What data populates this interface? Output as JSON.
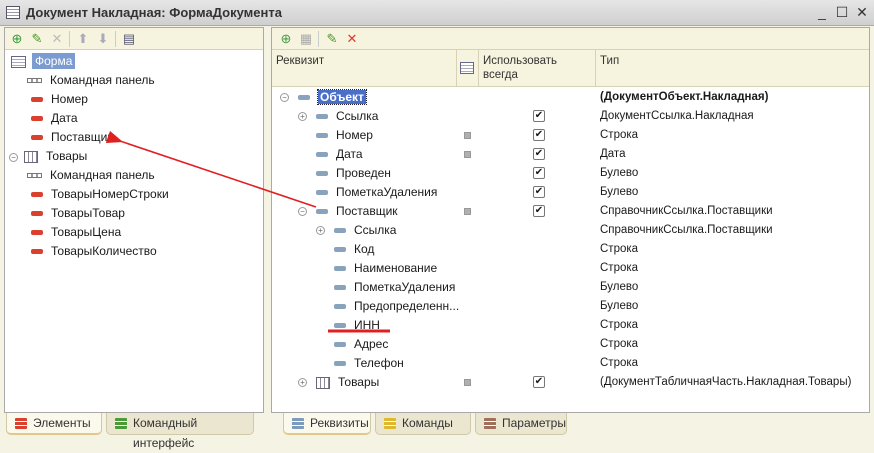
{
  "window": {
    "title": "Документ Накладная: ФормаДокумента",
    "buttons": [
      "minimize",
      "maximize",
      "close"
    ]
  },
  "left": {
    "toolbar": [
      "add-icon",
      "edit-icon",
      "delete-icon",
      "move-up-icon",
      "move-down-icon",
      "form-view-icon"
    ],
    "items": [
      {
        "label": "Форма",
        "level": 0,
        "icon": "form",
        "selected": true
      },
      {
        "label": "Командная панель",
        "level": 1,
        "icon": "command-panel"
      },
      {
        "label": "Номер",
        "level": 1,
        "icon": "field"
      },
      {
        "label": "Дата",
        "level": 1,
        "icon": "field"
      },
      {
        "label": "Поставщик",
        "level": 1,
        "icon": "field"
      },
      {
        "label": "Товары",
        "level": 0,
        "icon": "table",
        "expanded": true
      },
      {
        "label": "Командная панель",
        "level": 1,
        "icon": "command-panel"
      },
      {
        "label": "ТоварыНомерСтроки",
        "level": 1,
        "icon": "field"
      },
      {
        "label": "ТоварыТовар",
        "level": 1,
        "icon": "field"
      },
      {
        "label": "ТоварыЦена",
        "level": 1,
        "icon": "field"
      },
      {
        "label": "ТоварыКоличество",
        "level": 1,
        "icon": "field"
      }
    ],
    "tabs": [
      {
        "label": "Элементы",
        "color": "#d9402e",
        "active": true
      },
      {
        "label": "Командный интерфейс",
        "color": "#4c9a3a"
      }
    ]
  },
  "right": {
    "toolbar": [
      "add-attribute-icon",
      "add-column-icon",
      "edit-icon",
      "delete-icon"
    ],
    "headers": {
      "name": "Реквизит",
      "use_always": "Использовать всегда",
      "type": "Тип"
    },
    "rows": [
      {
        "name": "Объект",
        "level": 0,
        "toggle": "-",
        "type": "(ДокументОбъект.Накладная)",
        "selected": true,
        "bold_type": true
      },
      {
        "name": "Ссылка",
        "level": 1,
        "toggle": "+",
        "square": false,
        "checked": true,
        "type": "ДокументСсылка.Накладная"
      },
      {
        "name": "Номер",
        "level": 1,
        "square": true,
        "checked": true,
        "type": "Строка"
      },
      {
        "name": "Дата",
        "level": 1,
        "square": true,
        "checked": true,
        "type": "Дата"
      },
      {
        "name": "Проведен",
        "level": 1,
        "checked": true,
        "type": "Булево"
      },
      {
        "name": "ПометкаУдаления",
        "level": 1,
        "checked": true,
        "type": "Булево"
      },
      {
        "name": "Поставщик",
        "level": 1,
        "toggle": "-",
        "square": true,
        "checked": true,
        "type": "СправочникСсылка.Поставщики"
      },
      {
        "name": "Ссылка",
        "level": 2,
        "toggle": "+",
        "type": "СправочникСсылка.Поставщики"
      },
      {
        "name": "Код",
        "level": 2,
        "type": "Строка"
      },
      {
        "name": "Наименование",
        "level": 2,
        "type": "Строка"
      },
      {
        "name": "ПометкаУдаления",
        "level": 2,
        "type": "Булево"
      },
      {
        "name": "Предопределенн...",
        "level": 2,
        "type": "Булево"
      },
      {
        "name": "ИНН",
        "level": 2,
        "type": "Строка",
        "underlined": true
      },
      {
        "name": "Адрес",
        "level": 2,
        "type": "Строка"
      },
      {
        "name": "Телефон",
        "level": 2,
        "type": "Строка"
      },
      {
        "name": "Товары",
        "level": 1,
        "toggle": "+",
        "icon": "table",
        "square": true,
        "checked": true,
        "type": "(ДокументТабличнаяЧасть.Накладная.Товары)"
      }
    ],
    "tabs": [
      {
        "label": "Реквизиты",
        "color": "#7d9bbd",
        "active": true
      },
      {
        "label": "Команды",
        "color": "#e0b830"
      },
      {
        "label": "Параметры",
        "color": "#a0705a"
      }
    ]
  },
  "annotation": {
    "arrow_color": "#e02020",
    "from": "Поставщик (элементы)",
    "to": "Поставщик (реквизит)"
  }
}
